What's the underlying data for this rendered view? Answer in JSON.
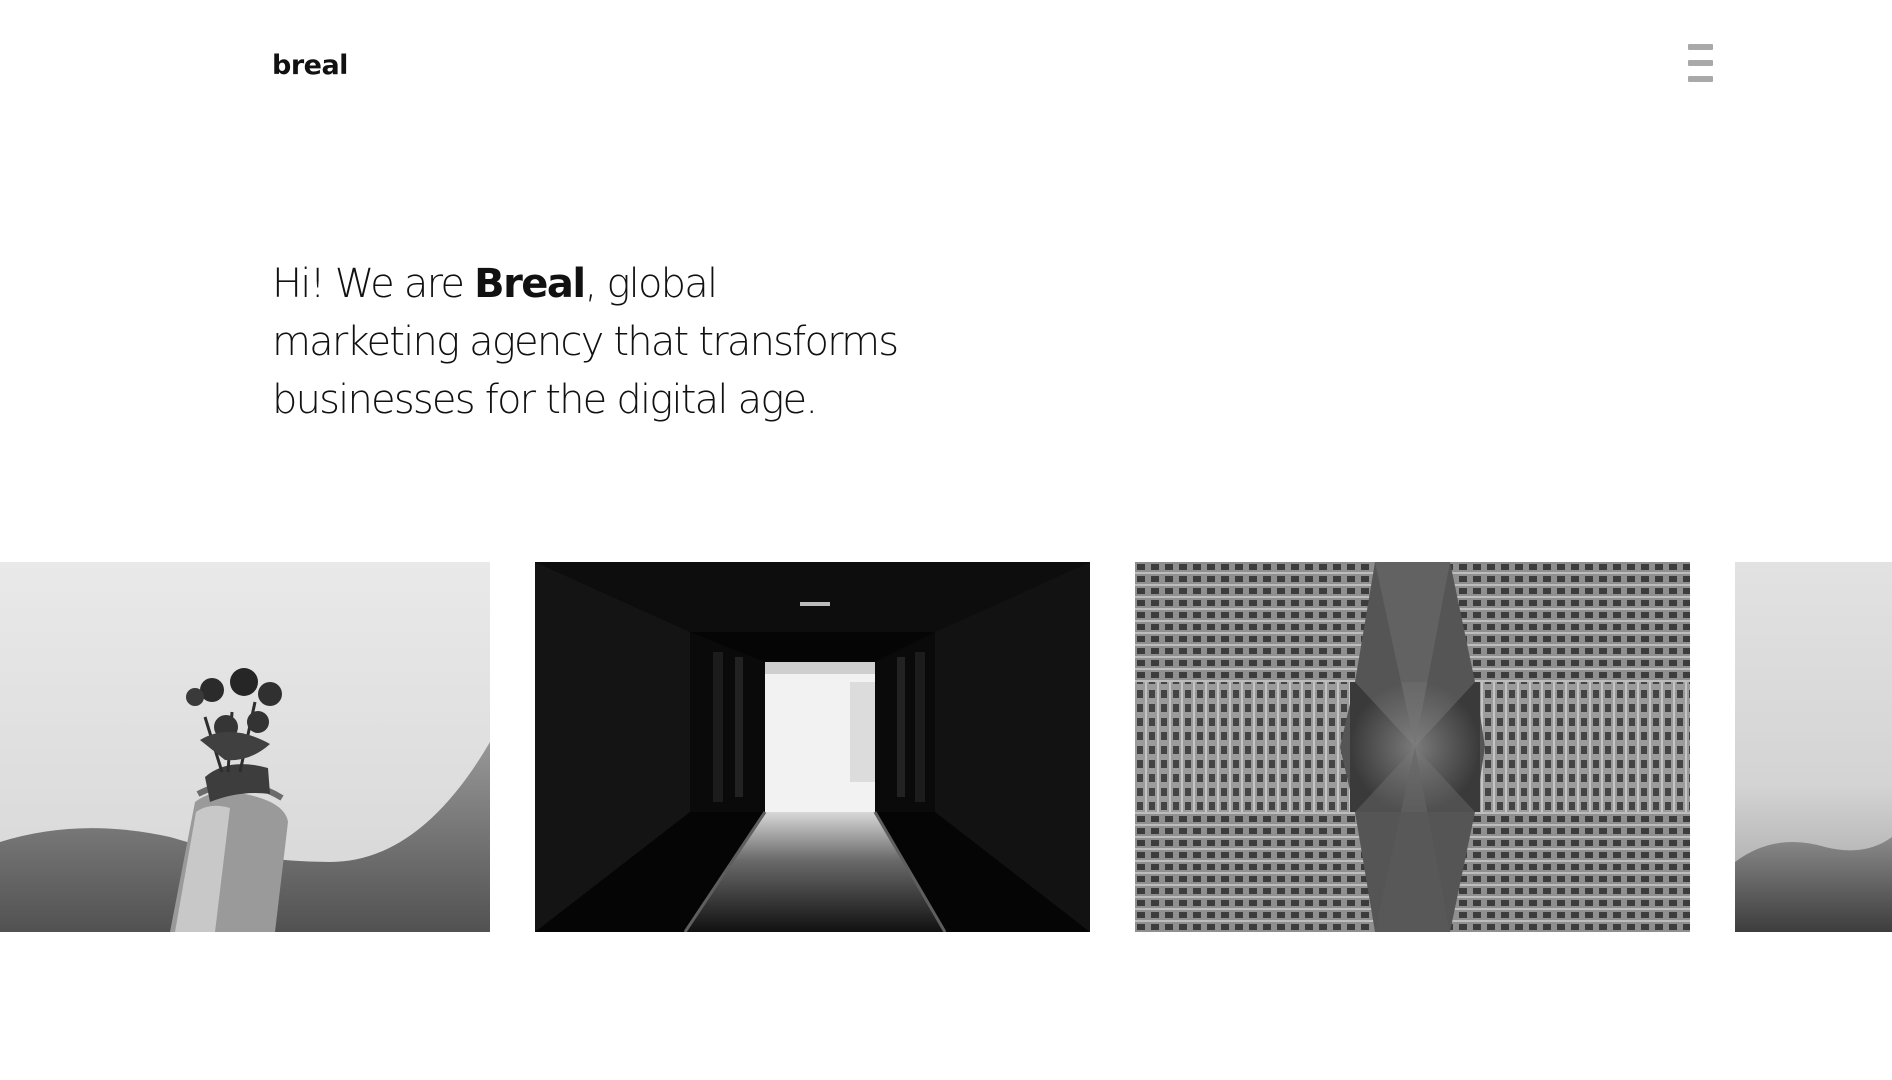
{
  "header": {
    "logo_text": "breal",
    "menu_icon": "hamburger-menu-icon"
  },
  "hero": {
    "intro": "Hi! We are ",
    "brand": "Breal",
    "rest": ", global marketing agency that transforms businesses for the digital age."
  },
  "gallery": {
    "items": [
      {
        "subject": "hand holding flowers"
      },
      {
        "subject": "dark corridor"
      },
      {
        "subject": "looking up between high-rise buildings"
      },
      {
        "subject": "misty landscape"
      }
    ]
  },
  "colors": {
    "background": "#ffffff",
    "text": "#111111",
    "menu_icon": "#a9a9a9"
  }
}
